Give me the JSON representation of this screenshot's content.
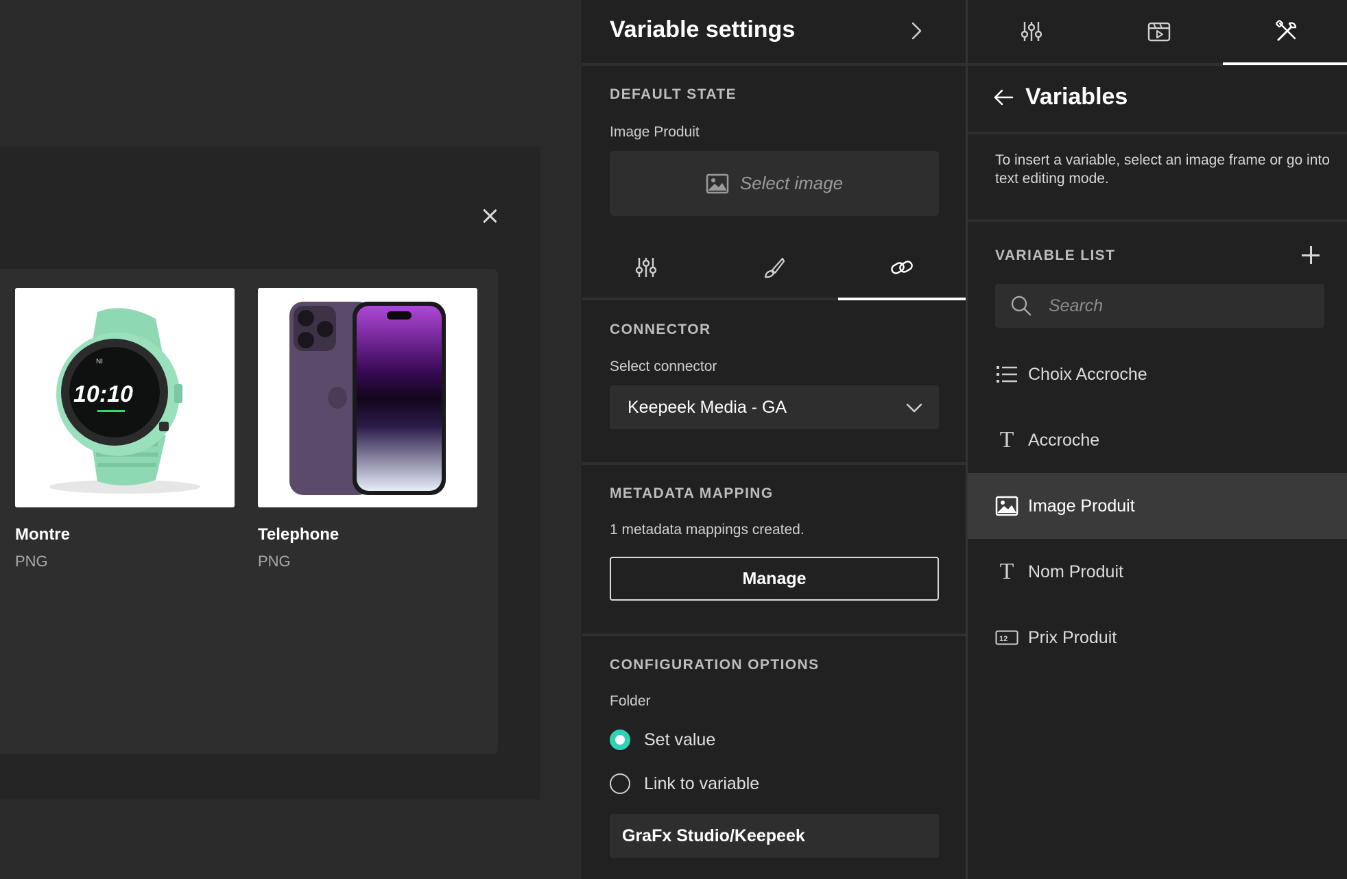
{
  "modal": {
    "assets": [
      {
        "name": "Montre",
        "type": "PNG"
      },
      {
        "name": "Telephone",
        "type": "PNG"
      }
    ]
  },
  "watch_face": {
    "top": "NI",
    "time": "10:10"
  },
  "variable_settings": {
    "title": "Variable settings",
    "default_state": {
      "section": "DEFAULT STATE",
      "field_label": "Image Produit",
      "placeholder": "Select image"
    },
    "tabs": [
      "sliders-icon",
      "brush-icon",
      "link-icon"
    ],
    "connector": {
      "section": "CONNECTOR",
      "label": "Select connector",
      "value": "Keepeek Media - GA"
    },
    "metadata": {
      "section": "METADATA MAPPING",
      "info": "1 metadata mappings created.",
      "button": "Manage"
    },
    "config": {
      "section": "CONFIGURATION OPTIONS",
      "folder_label": "Folder",
      "options": [
        "Set value",
        "Link to variable"
      ],
      "selected": "Set value",
      "folder_value": "GraFx Studio/Keepeek"
    }
  },
  "variables_panel": {
    "top_tabs": [
      "settings-sliders-icon",
      "film-icon",
      "tools-icon"
    ],
    "active_tab": "tools-icon",
    "title": "Variables",
    "hint": "To insert a variable, select an image frame or go into text editing mode.",
    "list_section": "VARIABLE LIST",
    "search_placeholder": "Search",
    "items": [
      {
        "label": "Choix Accroche",
        "icon": "list-icon"
      },
      {
        "label": "Accroche",
        "icon": "text-icon"
      },
      {
        "label": "Image Produit",
        "icon": "image-icon",
        "active": true
      },
      {
        "label": "Nom Produit",
        "icon": "text-icon"
      },
      {
        "label": "Prix Produit",
        "icon": "number-icon"
      }
    ]
  },
  "colors": {
    "accent": "#2fd2b4",
    "panel": "#212121",
    "field": "#2e2e2e"
  }
}
